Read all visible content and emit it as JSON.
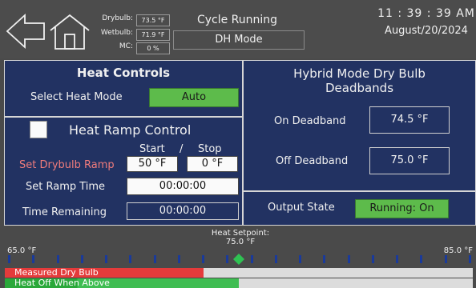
{
  "header": {
    "sensors": [
      {
        "label": "Drybulb:",
        "value": "73.5 °F"
      },
      {
        "label": "Wetbulb:",
        "value": "71.9 °F"
      },
      {
        "label": "MC:",
        "value": "0 %"
      }
    ],
    "cycle_status": "Cycle Running",
    "mode": "DH Mode",
    "clock": "11 : 39 : 39  AM",
    "date": "August/20/2024"
  },
  "heat_controls": {
    "title": "Heat Controls",
    "select_heat_mode_label": "Select Heat Mode",
    "heat_mode_value": "Auto"
  },
  "heat_ramp": {
    "title": "Heat Ramp Control",
    "start_label": "Start",
    "separator": "/",
    "stop_label": "Stop",
    "set_drybulb_ramp_label": "Set Drybulb Ramp",
    "start_value": "50 °F",
    "stop_value": "0 °F",
    "set_ramp_time_label": "Set Ramp Time",
    "ramp_time_value": "00:00:00",
    "time_remaining_label": "Time Remaining",
    "time_remaining_value": "00:00:00"
  },
  "hybrid": {
    "title_line1": "Hybrid Mode Dry Bulb",
    "title_line2": "Deadbands",
    "on_deadband_label": "On Deadband",
    "on_deadband_value": "74.5 °F",
    "off_deadband_label": "Off Deadband",
    "off_deadband_value": "75.0 °F"
  },
  "output": {
    "label": "Output State",
    "value": "Running: On"
  },
  "setpoint_scale": {
    "title": "Heat Setpoint:",
    "setpoint_value": "75.0 °F",
    "min_label": "65.0 °F",
    "max_label": "85.0 °F",
    "range": [
      65.0,
      85.0
    ],
    "setpoint": 75.0,
    "tick_count": 20,
    "measured_label": "Measured Dry Bulb",
    "measured_value": 73.5,
    "heat_off_label": "Heat Off When Above",
    "heat_off_value": 75.0,
    "heat_off_band_start": 68.1,
    "colors": {
      "measured": "#e43b3b",
      "heat_off": "#3fbd52",
      "setpoint_marker": "#2fc252",
      "tick": "#1a3a9a"
    }
  }
}
